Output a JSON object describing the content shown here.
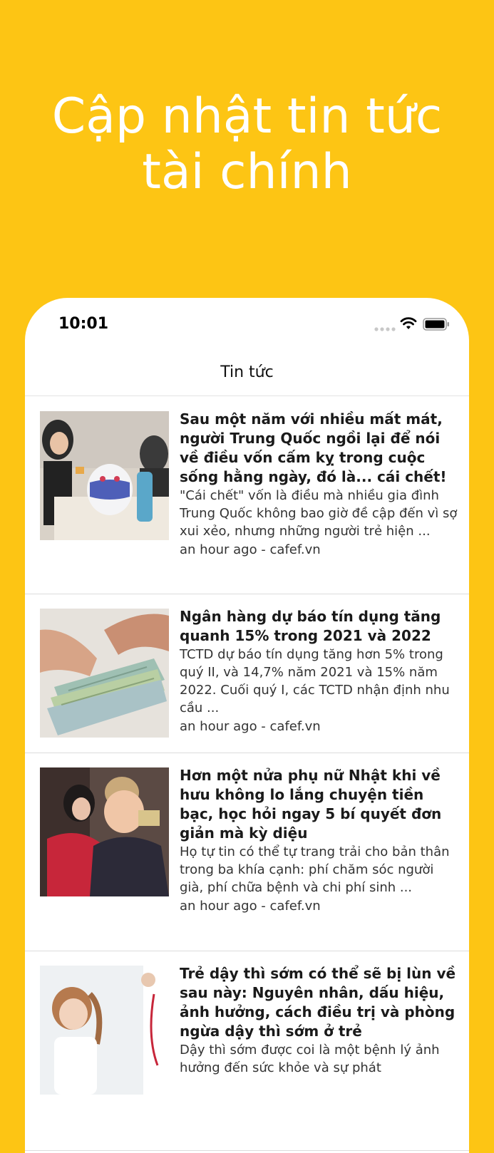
{
  "hero": {
    "line1": "Cập nhật tin tức",
    "line2": "tài chính"
  },
  "status_bar": {
    "time": "10:01",
    "icons": [
      "signal-icon",
      "wifi-icon",
      "battery-icon"
    ]
  },
  "nav": {
    "title": "Tin tức"
  },
  "colors": {
    "background": "#FDC514",
    "card": "#ffffff"
  },
  "news": [
    {
      "title": "Sau một năm với nhiều mất mát, người Trung Quốc ngồi lại để nói về điều vốn cấm kỵ trong cuộc sống hằng ngày, đó là... cái chết!",
      "description": "\"Cái chết\" vốn là điều mà nhiều gia đình Trung Quốc không bao giờ đề cập đến vì sợ xui xẻo, nhưng những người trẻ hiện ...",
      "meta": "an hour ago - cafef.vn"
    },
    {
      "title": "Ngân hàng dự báo tín dụng tăng quanh 15% trong 2021 và 2022",
      "description": "TCTD dự báo tín dụng tăng hơn 5% trong quý II, và 14,7% năm 2021 và 15% năm 2022. Cuối quý I, các TCTD nhận định nhu cầu ...",
      "meta": "an hour ago - cafef.vn"
    },
    {
      "title": "Hơn một nửa phụ nữ Nhật khi về hưu không lo lắng chuyện tiền bạc, học hỏi ngay 5 bí quyết đơn giản mà kỳ diệu",
      "description": "Họ tự tin có thể tự trang trải cho bản thân trong ba khía cạnh: phí chăm sóc người già, phí chữa bệnh và chi phí sinh ...",
      "meta": "an hour ago - cafef.vn"
    },
    {
      "title": "Trẻ dậy thì sớm có thể sẽ bị lùn về sau này: Nguyên nhân, dấu hiệu, ảnh hưởng, cách điều trị và phòng ngừa dậy thì sớm ở trẻ",
      "description": "Dậy thì sớm được coi là một bệnh lý ảnh hưởng đến sức khỏe và sự phát",
      "meta": ""
    }
  ]
}
